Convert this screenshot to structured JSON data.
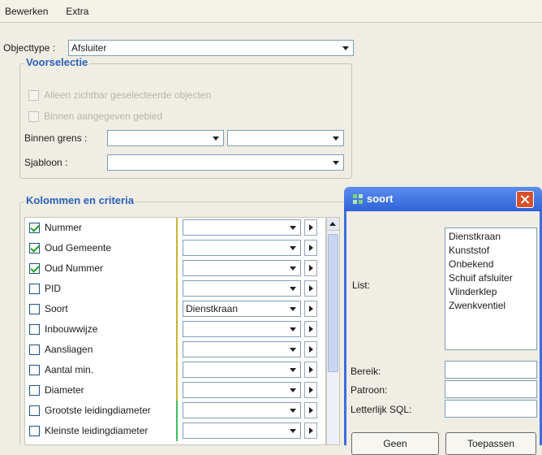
{
  "menubar": {
    "items": [
      "Bewerken",
      "Extra"
    ]
  },
  "objecttype": {
    "label": "Objecttype :",
    "value": "Afsluiter"
  },
  "voorselectie": {
    "title": "Voorselectie",
    "option1": "Alleen zichtbar geselecteerde objecten",
    "option2": "Binnen aangegeven gebied",
    "binnen_grens_label": "Binnen grens :",
    "sjabloon_label": "Sjabloon :"
  },
  "kolommen": {
    "title": "Kolommen en criteria",
    "rows": [
      {
        "label": "Nummer",
        "checked": true,
        "value": "",
        "marker": "#c8b52e"
      },
      {
        "label": "Oud Gemeente",
        "checked": true,
        "value": "",
        "marker": "#c8b52e"
      },
      {
        "label": "Oud Nummer",
        "checked": true,
        "value": "",
        "marker": "#c8b52e"
      },
      {
        "label": "PID",
        "checked": false,
        "value": "",
        "marker": "#c8b52e"
      },
      {
        "label": "Soort",
        "checked": false,
        "value": "Dienstkraan",
        "marker": "#c8b52e"
      },
      {
        "label": "Inbouwwijze",
        "checked": false,
        "value": "",
        "marker": "#c8b52e"
      },
      {
        "label": "Aansliagen",
        "checked": false,
        "value": "",
        "marker": "#c8b52e"
      },
      {
        "label": "Aantal min.",
        "checked": false,
        "value": "",
        "marker": "#c8b52e"
      },
      {
        "label": "Diameter",
        "checked": false,
        "value": "",
        "marker": "#c8b52e"
      },
      {
        "label": "Grootste leidingdiameter",
        "checked": false,
        "value": "",
        "marker": "#3fbf62"
      },
      {
        "label": "Kleinste leidingdiameter",
        "checked": false,
        "value": "",
        "marker": "#3fbf62"
      }
    ]
  },
  "soort_popup": {
    "title": "soort",
    "list_label": "List:",
    "list_items": [
      "Dienstkraan",
      "Kunststof",
      "Onbekend",
      "Schuif afsluiter",
      "Vlinderklep",
      "Zwenkventiel"
    ],
    "bereik_label": "Bereik:",
    "patroon_label": "Patroon:",
    "sql_label": "Letterlijk SQL:",
    "geen_button": "Geen",
    "toepassen_button": "Toepassen"
  },
  "colors": {
    "accent": "#2b61b7",
    "titlebar": "#2f62d5",
    "close": "#d9502a"
  },
  "icons": {
    "window": "puzzle-icon",
    "close": "close-icon",
    "dropdown": "chevron-down-icon",
    "row_action": "play-icon"
  }
}
